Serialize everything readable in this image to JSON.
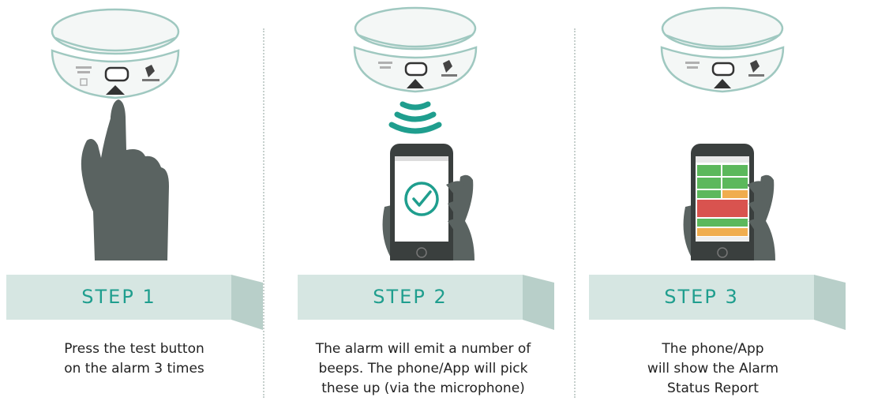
{
  "colors": {
    "accent": "#1f9e8e",
    "ribbon": "#d6e6e2",
    "ribbon_fold": "#b8cfc9",
    "hand": "#5a6361",
    "alarm_body": "#f4f7f6",
    "alarm_line": "#9fc8c0",
    "status_green": "#5cb85c",
    "status_orange": "#f0ad4e",
    "status_red": "#d9534f"
  },
  "steps": [
    {
      "title": "STEP 1",
      "description": "Press the test button\non the alarm 3 times",
      "illustration": [
        "smoke-alarm",
        "pointing-hand"
      ]
    },
    {
      "title": "STEP 2",
      "description": "The alarm will emit a number of\nbeeps. The phone/App will pick\nthese up (via the microphone)",
      "illustration": [
        "smoke-alarm",
        "sound-waves-icon",
        "hand-holding-phone",
        "checkmark-icon"
      ]
    },
    {
      "title": "STEP 3",
      "description": "The phone/App\nwill show the Alarm\nStatus Report",
      "illustration": [
        "smoke-alarm",
        "hand-holding-phone",
        "status-report-screen"
      ]
    }
  ]
}
